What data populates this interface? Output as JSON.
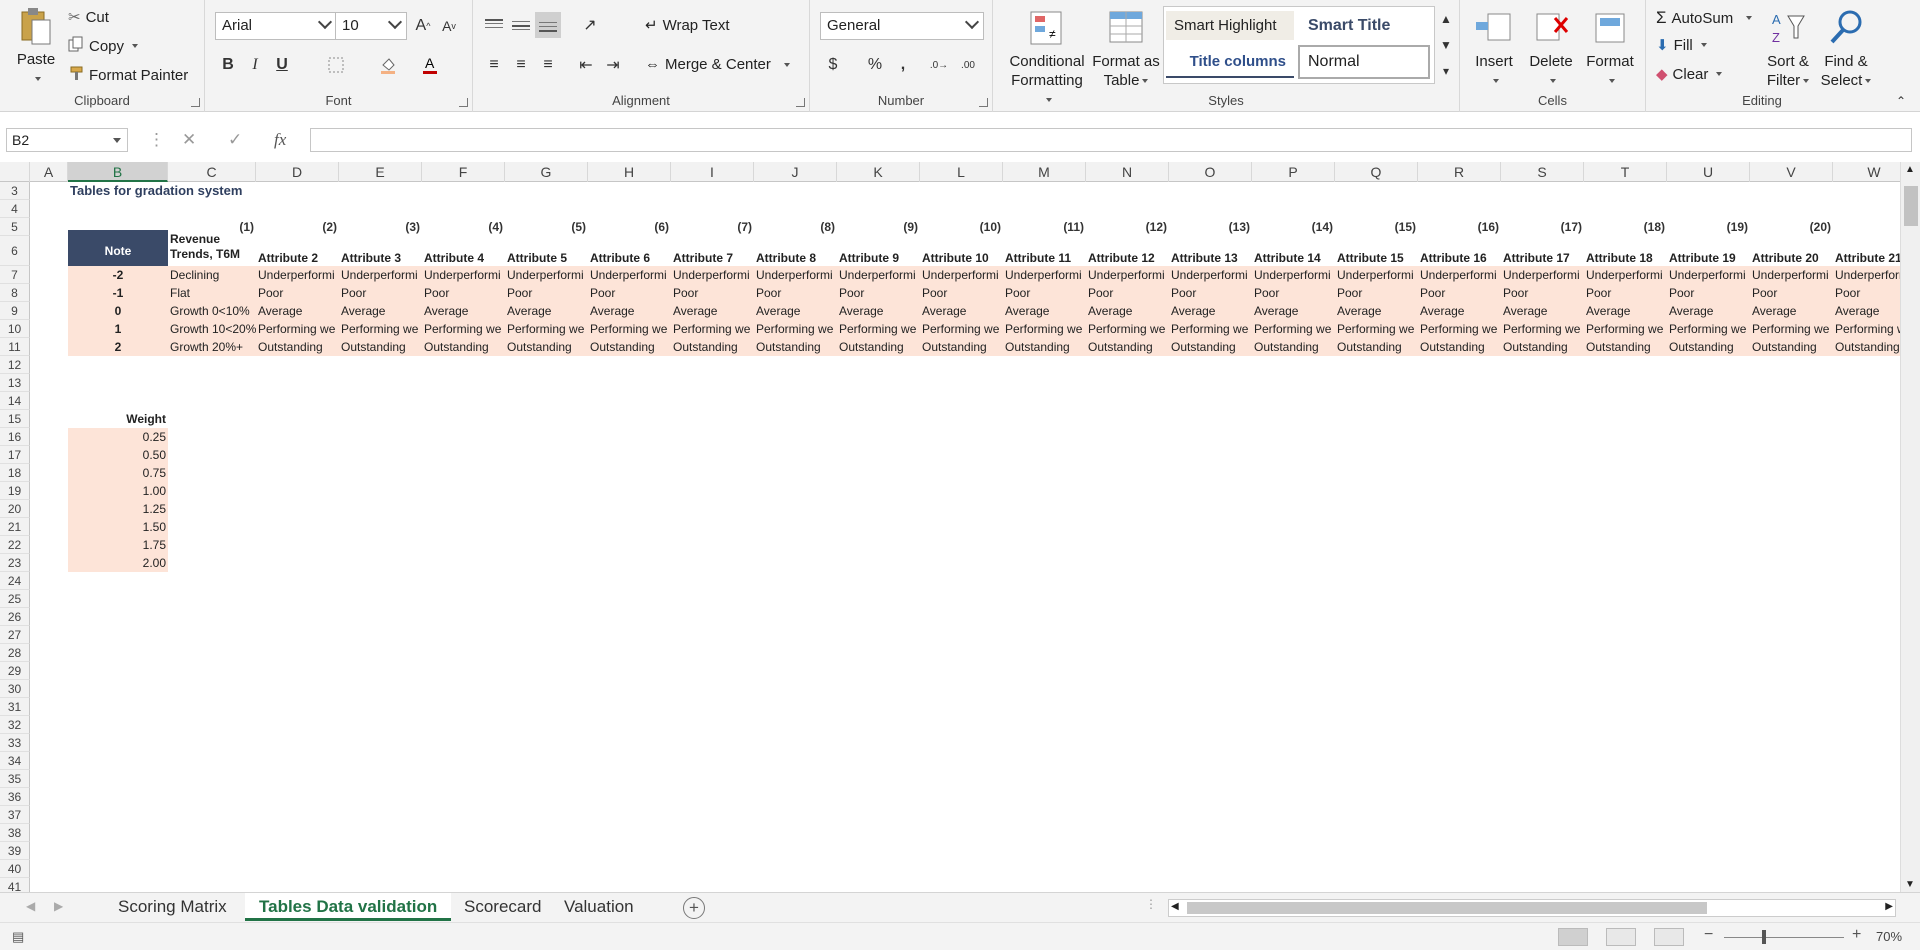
{
  "ribbon": {
    "clipboard": {
      "paste": "Paste",
      "cut": "Cut",
      "copy": "Copy",
      "format_painter": "Format Painter",
      "label": "Clipboard"
    },
    "font": {
      "name": "Arial",
      "size": "10",
      "label": "Font"
    },
    "alignment": {
      "wrap_text": "Wrap Text",
      "merge_center": "Merge & Center",
      "label": "Alignment"
    },
    "number": {
      "format": "General",
      "label": "Number",
      "percent": "%",
      "comma": ","
    },
    "styles": {
      "conditional": "Conditional",
      "conditional2": "Formatting",
      "format_as": "Format as",
      "format_as2": "Table",
      "smart_highlight": "Smart Highlight",
      "smart_title": "Smart Title",
      "title_columns": "Title columns",
      "normal": "Normal",
      "label": "Styles"
    },
    "cells": {
      "insert": "Insert",
      "delete": "Delete",
      "format": "Format",
      "label": "Cells"
    },
    "editing": {
      "autosum": "AutoSum",
      "fill": "Fill",
      "clear": "Clear",
      "sort": "Sort &",
      "sort2": "Filter",
      "find": "Find &",
      "find2": "Select",
      "label": "Editing"
    }
  },
  "formula_bar": {
    "name_box": "B2",
    "fx": "fx",
    "formula": ""
  },
  "columns": [
    "A",
    "B",
    "C",
    "D",
    "E",
    "F",
    "G",
    "H",
    "I",
    "J",
    "K",
    "L",
    "M",
    "N",
    "O",
    "P",
    "Q",
    "R",
    "S",
    "T",
    "U",
    "V",
    "W"
  ],
  "selected_column": "B",
  "row_numbers": [
    "3",
    "4",
    "5",
    "6",
    "7",
    "8",
    "9",
    "10",
    "11",
    "12",
    "13",
    "14",
    "15",
    "16",
    "17",
    "18",
    "19",
    "20",
    "21",
    "22",
    "23",
    "24",
    "25",
    "26",
    "27",
    "28",
    "29",
    "30",
    "31",
    "32",
    "33",
    "34",
    "35",
    "36",
    "37",
    "38",
    "39",
    "40",
    "41"
  ],
  "sheet": {
    "title": "Tables for gradation system",
    "note_header": "Note",
    "revenue_header": "Revenue Trends, T6M",
    "revenue_header_l1": "Revenue",
    "revenue_header_l2": "Trends, T6M",
    "column_numbers": [
      "(1)",
      "(2)",
      "(3)",
      "(4)",
      "(5)",
      "(6)",
      "(7)",
      "(8)",
      "(9)",
      "(10)",
      "(11)",
      "(12)",
      "(13)",
      "(14)",
      "(15)",
      "(16)",
      "(17)",
      "(18)",
      "(19)",
      "(20)"
    ],
    "attributes": [
      "Attribute 2",
      "Attribute 3",
      "Attribute 4",
      "Attribute 5",
      "Attribute 6",
      "Attribute 7",
      "Attribute 8",
      "Attribute 9",
      "Attribute 10",
      "Attribute 11",
      "Attribute 12",
      "Attribute 13",
      "Attribute 14",
      "Attribute 15",
      "Attribute 16",
      "Attribute 17",
      "Attribute 18",
      "Attribute 19",
      "Attribute 20",
      "Attribute 21"
    ],
    "grade_rows": [
      {
        "note": "-2",
        "revenue": "Declining",
        "value": "Underperformi"
      },
      {
        "note": "-1",
        "revenue": "Flat",
        "value": "Poor"
      },
      {
        "note": "0",
        "revenue": "Growth 0<10%",
        "value": "Average"
      },
      {
        "note": "1",
        "revenue": "Growth 10<20%",
        "value": "Performing we"
      },
      {
        "note": "2",
        "revenue": "Growth 20%+",
        "value": "Outstanding"
      }
    ],
    "weight_header": "Weight",
    "weights": [
      "0.25",
      "0.50",
      "0.75",
      "1.00",
      "1.25",
      "1.50",
      "1.75",
      "2.00"
    ]
  },
  "sheet_tabs": [
    "Scoring Matrix",
    "Tables Data validation",
    "Scorecard",
    "Valuation"
  ],
  "active_tab": "Tables Data validation",
  "status": {
    "zoom": "70%"
  },
  "colors": {
    "accent": "#217346",
    "peach": "#fde4d8",
    "navy": "#3a4a68"
  }
}
